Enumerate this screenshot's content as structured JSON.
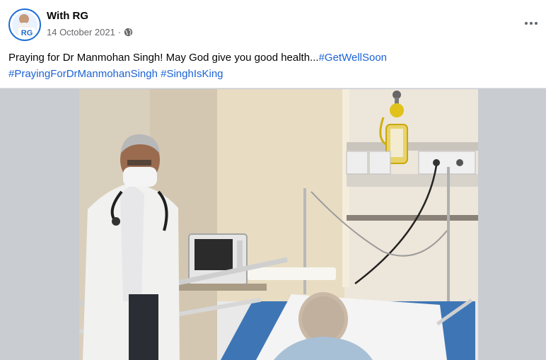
{
  "post": {
    "page_name": "With RG",
    "date": "14 October 2021",
    "separator": "·",
    "avatar_badge": "RG",
    "caption_text": "Praying for Dr Manmohan Singh! May God give you good health...",
    "hashtags": [
      "#GetWellSoon",
      "#PrayingForDrManmohanSingh",
      "#SinghIsKing"
    ],
    "more_icon": "more-horizontal-icon",
    "audience_icon": "globe-icon"
  },
  "colors": {
    "hashtag": "#1b63d6",
    "avatar_border": "#1f6fd1",
    "muted_text": "#65676b"
  }
}
